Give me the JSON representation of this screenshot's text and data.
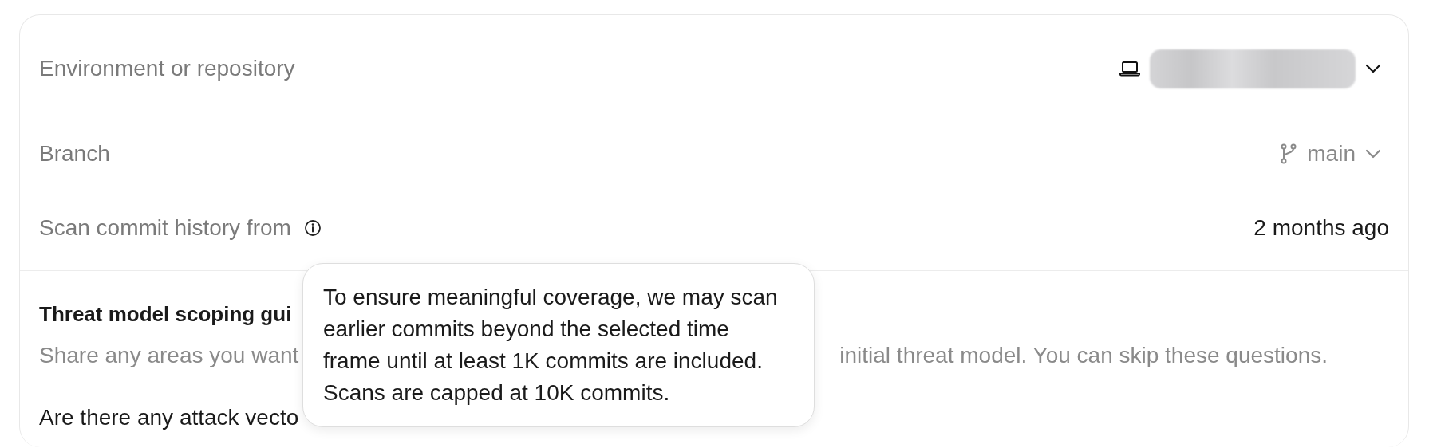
{
  "settings": [
    {
      "kind": "environment",
      "label": "Environment or repository",
      "redacted": true
    },
    {
      "kind": "branch",
      "label": "Branch",
      "value": "main"
    },
    {
      "kind": "history",
      "label": "Scan commit history from",
      "value": "2 months ago"
    }
  ],
  "tooltip": {
    "lines": [
      "To ensure meaningful coverage, we may scan",
      "earlier commits beyond the selected time",
      "frame until at least 1K commits are included.",
      "Scans are capped at 10K commits."
    ]
  },
  "guidance": {
    "title": "Threat model scoping gui",
    "description_left": "Share any areas you want",
    "description_right": "initial threat model. You can skip these questions.",
    "question": "Are there any attack vecto"
  }
}
